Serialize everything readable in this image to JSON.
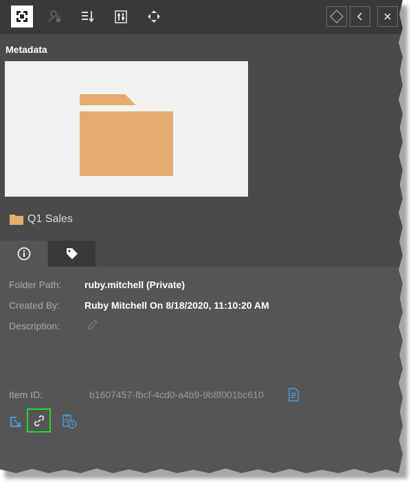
{
  "panel": {
    "section_title": "Metadata",
    "folder_name": "Q1 Sales"
  },
  "toolbar": {
    "icons": [
      "app-logo-icon",
      "user-lock-icon",
      "sort-list-icon",
      "tools-icon",
      "move-icon"
    ],
    "right_buttons": [
      "diamond-icon",
      "chevron-left-icon",
      "close-icon"
    ]
  },
  "tabs": [
    {
      "name": "info",
      "icon": "info-icon"
    },
    {
      "name": "tags",
      "icon": "tag-icon"
    }
  ],
  "details": {
    "folder_path_label": "Folder Path:",
    "folder_path_value": "ruby.mitchell (Private)",
    "created_by_label": "Created By:",
    "created_by_value": "Ruby Mitchell On 8/18/2020, 11:10:20 AM",
    "description_label": "Description:",
    "item_id_label": "Item ID:",
    "item_id_value": "b1607457-fbcf-4cd0-a4b9-9b8f001bc610"
  },
  "colors": {
    "panel_bg": "#4a4a4a",
    "toolbar_bg": "#393939",
    "content_bg": "#555555",
    "folder_color": "#e2ad6e",
    "accent_blue": "#4a9bd4",
    "highlight_green": "#22dd22"
  }
}
